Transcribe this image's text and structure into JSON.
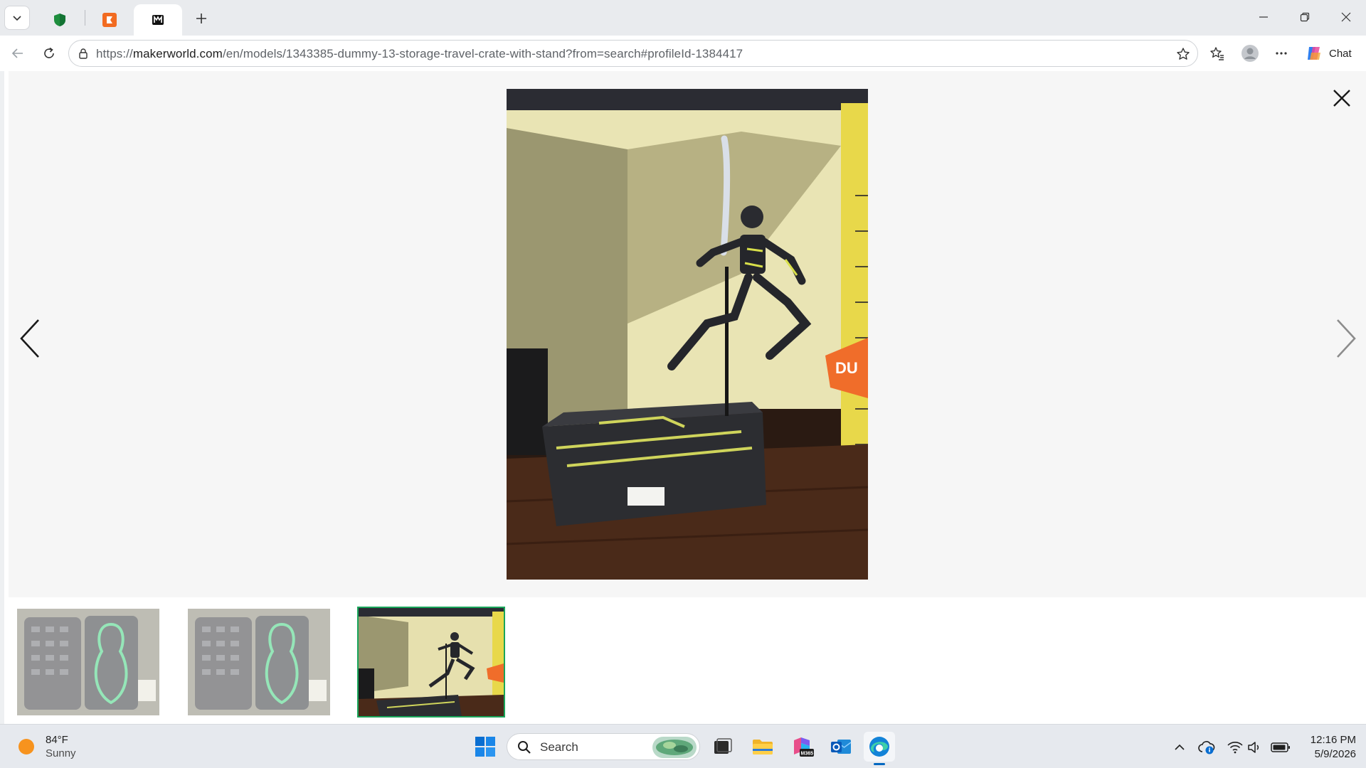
{
  "browser": {
    "url_prefix": "https://",
    "url_host": "makerworld.com",
    "url_path": "/en/models/1343385-dummy-13-storage-travel-crate-with-stand?from=search#profileId-1384417",
    "chat_label": "Chat"
  },
  "tabs": [
    {
      "icon": "green-shield-favicon-icon"
    },
    {
      "icon": "orange-app-favicon-icon"
    },
    {
      "icon": "makerworld-favicon-icon",
      "active": true
    }
  ],
  "gallery": {
    "thumbnail_count": 3,
    "selected_index": 2
  },
  "taskbar": {
    "weather_temp": "84°F",
    "weather_condition": "Sunny",
    "search_label": "Search",
    "time": "12:16 PM",
    "date": "5/9/2026"
  },
  "colors": {
    "accent_green": "#19a55a",
    "edge_blue": "#0067c0"
  }
}
